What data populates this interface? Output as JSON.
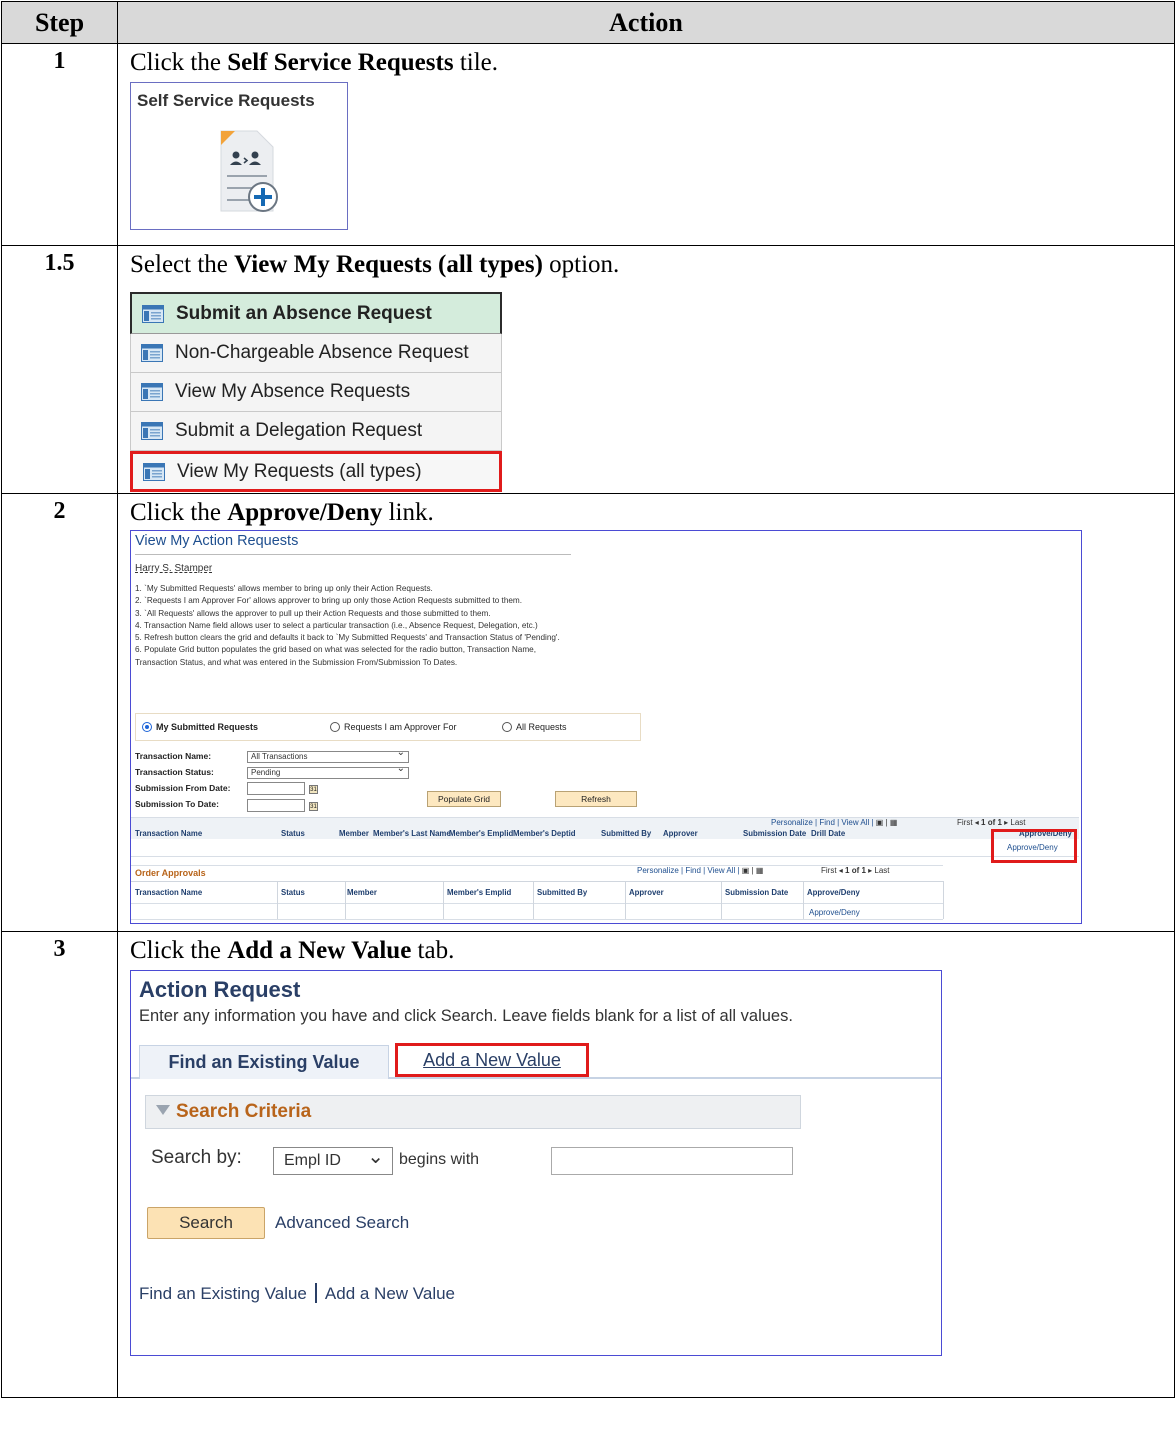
{
  "table": {
    "header_step": "Step",
    "header_action": "Action"
  },
  "steps": [
    {
      "num": "1",
      "pre": "Click the ",
      "bold": "Self Service Requests",
      "post": " tile.",
      "tile_title": "Self Service Requests"
    },
    {
      "num": "1.5",
      "pre": "Select the ",
      "bold": "View My Requests (all types)",
      "post": " option.",
      "menu": [
        "Submit an Absence Request",
        "Non-Chargeable Absence Request",
        "View My Absence Requests",
        "Submit a Delegation Request",
        "View My Requests (all types)"
      ]
    },
    {
      "num": "2",
      "pre": "Click the ",
      "bold": "Approve/Deny",
      "post": " link."
    },
    {
      "num": "3",
      "pre": "Click the ",
      "bold": "Add a New Value",
      "post": " tab."
    }
  ],
  "shot2": {
    "title": "View My Action Requests",
    "user": "Harry S. Stamper",
    "notes": [
      "1. `My Submitted Requests' allows member to bring up only their Action Requests.",
      "2. `Requests I am Approver For' allows approver to bring up only those Action Requests submitted to them.",
      "3. `All Requests' allows the approver to pull up their Action Requests and those submitted to them.",
      "4. Transaction Name field allows user to select a particular transaction (i.e., Absence Request, Delegation, etc.)",
      "5. Refresh button clears the grid and defaults it back to `My Submitted Requests' and Transaction Status of 'Pending'.",
      "6. Populate Grid button populates the grid based on what was selected for the radio button, Transaction Name,",
      "Transaction Status, and what was entered in the Submission From/Submission To Dates."
    ],
    "radios": [
      "My Submitted Requests",
      "Requests I am Approver For",
      "All Requests"
    ],
    "labels": {
      "transaction_name": "Transaction Name:",
      "transaction_status": "Transaction Status:",
      "submission_from": "Submission From Date:",
      "submission_to": "Submission To Date:"
    },
    "transaction_name_value": "All Transactions",
    "transaction_status_value": "Pending",
    "populate_btn": "Populate Grid",
    "refresh_btn": "Refresh",
    "grid_nav": "Personalize | Find | View All |",
    "grid_pager": "First",
    "grid_count": "1 of 1",
    "grid_last": "Last",
    "grid1_cols": [
      "Transaction Name",
      "Status",
      "Member",
      "Member's Last Name",
      "Member's Emplid",
      "Member's Deptid",
      "Submitted By",
      "Approver",
      "Submission Date",
      "Drill Date",
      "Approve/Deny"
    ],
    "approve_deny": "Approve/Deny",
    "order_title": "Order Approvals",
    "grid2_cols": [
      "Transaction Name",
      "Status",
      "Member",
      "Member's Emplid",
      "Submitted By",
      "Approver",
      "Submission Date",
      "Approve/Deny"
    ]
  },
  "shot3": {
    "title": "Action Request",
    "subtitle": "Enter any information you have and click Search. Leave fields blank for a list of all values.",
    "tab_find": "Find an Existing Value",
    "tab_add": "Add a New Value",
    "criteria": "Search Criteria",
    "search_by": "Search by:",
    "search_by_value": "Empl ID",
    "begins_with": "begins with",
    "search_btn": "Search",
    "advanced": "Advanced Search",
    "foot_find": "Find an Existing Value",
    "foot_add": "Add a New Value"
  }
}
